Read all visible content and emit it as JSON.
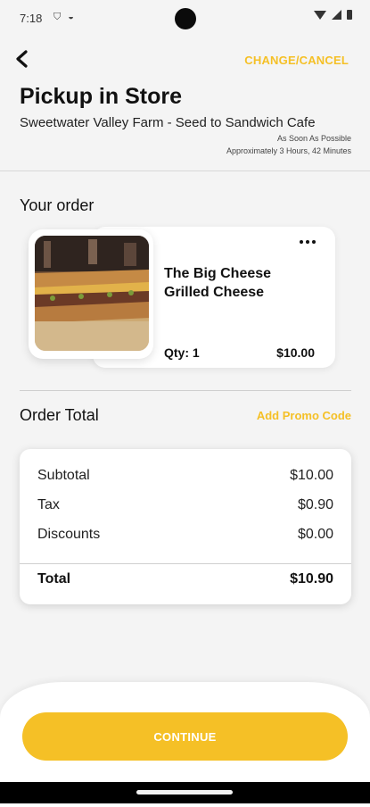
{
  "status_bar": {
    "time": "7:18",
    "left_icons": [
      "shield-icon",
      "cup-icon"
    ],
    "right_icons": [
      "wifi-icon",
      "signal-icon",
      "battery-icon"
    ]
  },
  "header": {
    "back_icon": "arrow-left-icon",
    "change_cancel_label": "CHANGE/CANCEL",
    "title": "Pickup in Store",
    "store_name": "Sweetwater Valley Farm - Seed to Sandwich Cafe",
    "pickup_time": "As Soon As Possible",
    "pickup_eta": "Approximately 3 Hours, 42 Minutes"
  },
  "order": {
    "heading": "Your order",
    "items": [
      {
        "name": "The Big Cheese Grilled Cheese",
        "qty_label": "Qty: 1",
        "price": "$10.00",
        "menu_icon": "more-options-icon",
        "image": "grilled-cheese-photo"
      }
    ]
  },
  "totals": {
    "heading": "Order Total",
    "promo_label": "Add Promo Code",
    "rows": [
      {
        "label": "Subtotal",
        "value": "$10.00"
      },
      {
        "label": "Tax",
        "value": "$0.90"
      },
      {
        "label": "Discounts",
        "value": "$0.00"
      }
    ],
    "total": {
      "label": "Total",
      "value": "$10.90"
    }
  },
  "footer": {
    "continue_label": "CONTINUE"
  },
  "colors": {
    "accent": "#f5c026",
    "background": "#f4f4f4",
    "card": "#ffffff",
    "text": "#111111"
  }
}
